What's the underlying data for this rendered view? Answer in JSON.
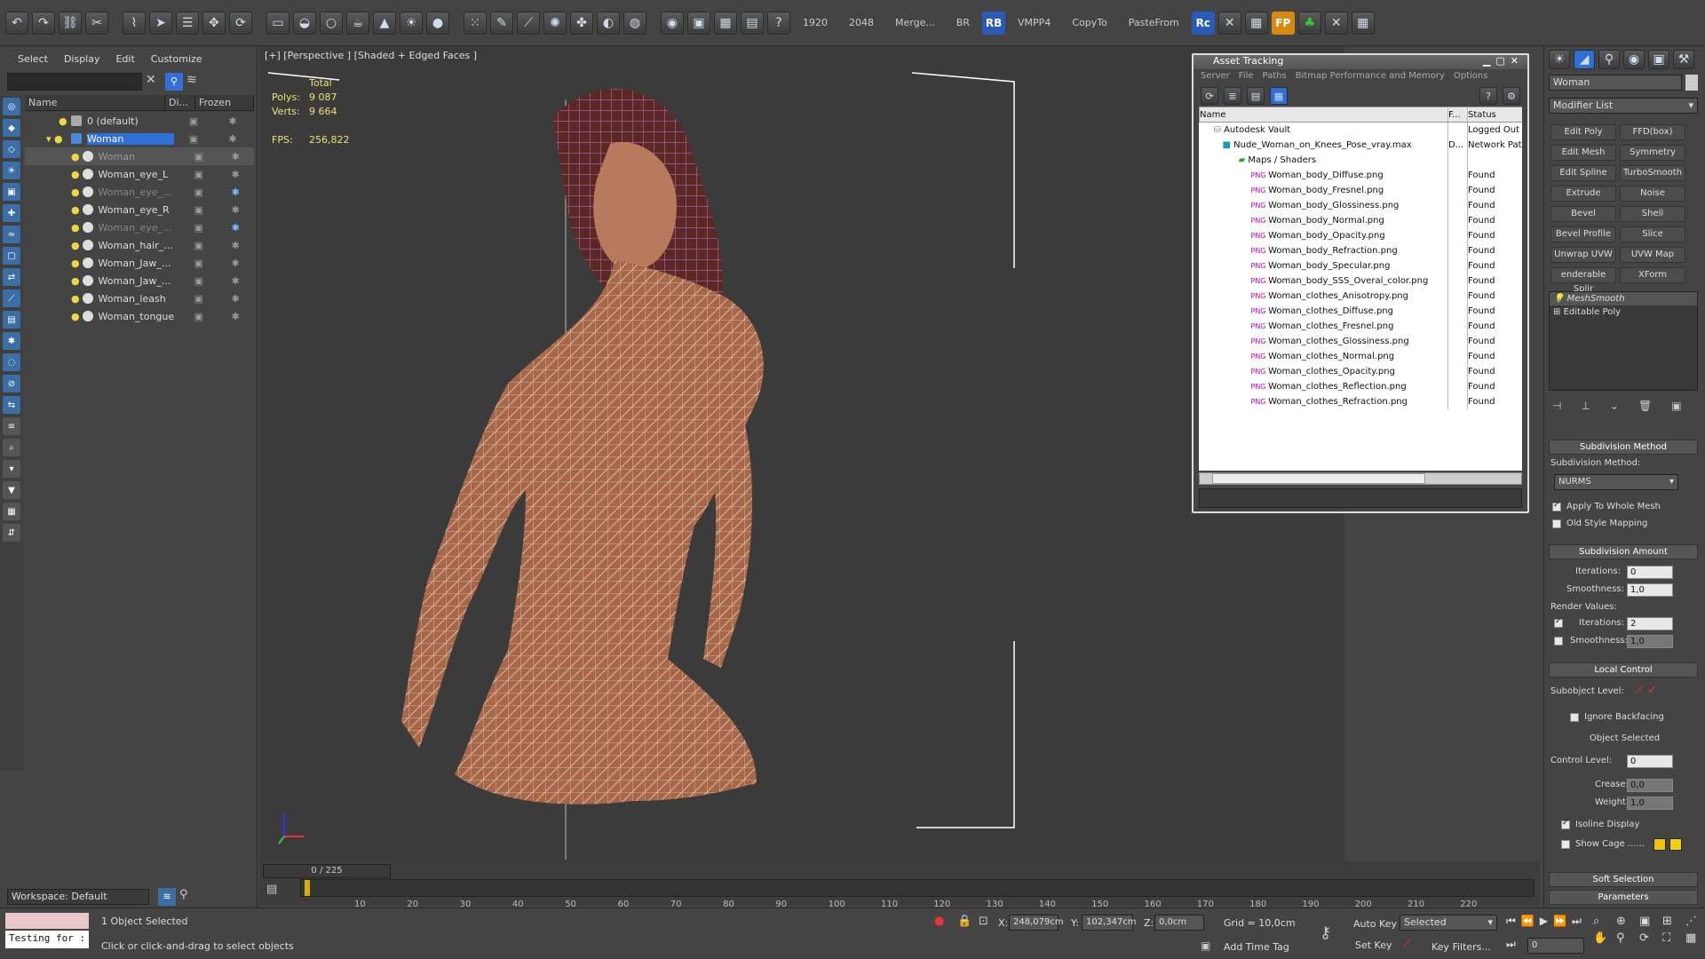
{
  "toolbar": {
    "res1": "1920",
    "res2": "2048",
    "merge": "Merge...",
    "br": "BR",
    "rb": "RB",
    "vmpp": "VMPP4",
    "copyto": "CopyTo",
    "pastefrom": "PasteFrom",
    "rc": "Rc",
    "fp": "FP"
  },
  "scene": {
    "menus": [
      "Select",
      "Display",
      "Edit",
      "Customize"
    ],
    "columns": [
      "Name",
      "Di...",
      "Frozen"
    ],
    "rows": [
      {
        "name": "0 (default)"
      },
      {
        "name": "Woman"
      },
      {
        "name": "Woman"
      },
      {
        "name": "Woman_eye_L"
      },
      {
        "name": "Woman_eye_..."
      },
      {
        "name": "Woman_eye_R"
      },
      {
        "name": "Woman_eye_..."
      },
      {
        "name": "Woman_hair_..."
      },
      {
        "name": "Woman_Jaw_..."
      },
      {
        "name": "Woman_Jaw_..."
      },
      {
        "name": "Woman_leash"
      },
      {
        "name": "Woman_tongue"
      }
    ],
    "workspace": "Workspace: Default"
  },
  "viewport": {
    "label": "[+] [Perspective ] [Shaded + Edged Faces ]",
    "stats_total": "Total",
    "polys_label": "Polys:",
    "polys_value": "9 087",
    "verts_label": "Verts:",
    "verts_value": "9 664",
    "fps_label": "FPS:",
    "fps_value": "256,822"
  },
  "asset": {
    "title": "Asset Tracking",
    "menus": [
      "Server",
      "File",
      "Paths",
      "Bitmap Performance and Memory",
      "Options"
    ],
    "headers": [
      "Name",
      "F...",
      "Status"
    ],
    "rows": [
      {
        "name": "Autodesk Vault",
        "f": "",
        "status": "Logged Out"
      },
      {
        "name": "Nude_Woman_on_Knees_Pose_vray.max",
        "f": "D...",
        "status": "Network Path"
      },
      {
        "name": "Maps / Shaders",
        "f": "",
        "status": ""
      },
      {
        "name": "Woman_body_Diffuse.png",
        "f": "",
        "status": "Found"
      },
      {
        "name": "Woman_body_Fresnel.png",
        "f": "",
        "status": "Found"
      },
      {
        "name": "Woman_body_Glossiness.png",
        "f": "",
        "status": "Found"
      },
      {
        "name": "Woman_body_Normal.png",
        "f": "",
        "status": "Found"
      },
      {
        "name": "Woman_body_Opacity.png",
        "f": "",
        "status": "Found"
      },
      {
        "name": "Woman_body_Refraction.png",
        "f": "",
        "status": "Found"
      },
      {
        "name": "Woman_body_Specular.png",
        "f": "",
        "status": "Found"
      },
      {
        "name": "Woman_body_SSS_Overal_color.png",
        "f": "",
        "status": "Found"
      },
      {
        "name": "Woman_clothes_Anisotropy.png",
        "f": "",
        "status": "Found"
      },
      {
        "name": "Woman_clothes_Diffuse.png",
        "f": "",
        "status": "Found"
      },
      {
        "name": "Woman_clothes_Fresnel.png",
        "f": "",
        "status": "Found"
      },
      {
        "name": "Woman_clothes_Glossiness.png",
        "f": "",
        "status": "Found"
      },
      {
        "name": "Woman_clothes_Normal.png",
        "f": "",
        "status": "Found"
      },
      {
        "name": "Woman_clothes_Opacity.png",
        "f": "",
        "status": "Found"
      },
      {
        "name": "Woman_clothes_Reflection.png",
        "f": "",
        "status": "Found"
      },
      {
        "name": "Woman_clothes_Refraction.png",
        "f": "",
        "status": "Found"
      }
    ]
  },
  "command": {
    "object_name": "Woman",
    "modifier_list": "Modifier List",
    "modifiers": [
      "Edit Poly",
      "FFD(box)",
      "Edit Mesh",
      "Symmetry",
      "Edit Spline",
      "TurboSmooth",
      "Extrude",
      "Noise",
      "Bevel",
      "Shell",
      "Bevel Profile",
      "Slice",
      "Unwrap UVW",
      "UVW Map",
      "enderable Splir",
      "XForm"
    ],
    "stack": [
      "MeshSmooth",
      "Editable Poly"
    ],
    "subdiv_method_title": "Subdivision Method",
    "subdiv_method_label": "Subdivision Method:",
    "subdiv_method_value": "NURMS",
    "apply_whole": "Apply To Whole Mesh",
    "old_style": "Old Style Mapping",
    "subdiv_amount_title": "Subdivision Amount",
    "iterations_label": "Iterations:",
    "iterations_value": "0",
    "smoothness_label": "Smoothness:",
    "smoothness_value": "1,0",
    "render_values": "Render Values:",
    "r_iterations_label": "Iterations:",
    "r_iterations_value": "2",
    "r_smoothness_label": "Smoothness:",
    "r_smoothness_value": "1,0",
    "local_control_title": "Local Control",
    "subobject_level": "Subobject Level:",
    "ignore_backfacing": "Ignore Backfacing",
    "object_selected": "Object Selected",
    "control_level_label": "Control Level:",
    "control_level_value": "0",
    "crease_label": "Crease:",
    "crease_value": "0,0",
    "weight_label": "Weight:",
    "weight_value": "1,0",
    "isoline": "Isoline Display",
    "show_cage": "Show Cage ......",
    "soft_selection": "Soft Selection",
    "parameters": "Parameters"
  },
  "timeline": {
    "frame": "0 / 225",
    "ticks": [
      "10",
      "20",
      "30",
      "40",
      "50",
      "60",
      "70",
      "80",
      "90",
      "100",
      "110",
      "120",
      "130",
      "140",
      "150",
      "160",
      "170",
      "180",
      "190",
      "200",
      "210",
      "220"
    ]
  },
  "status": {
    "maxscript": "Testing for :",
    "selected": "1 Object Selected",
    "prompt": "Click or click-and-drag to select objects",
    "x_label": "X:",
    "x_value": "248,079cm",
    "y_label": "Y:",
    "y_value": "102,347cm",
    "z_label": "Z:",
    "z_value": "0,0cm",
    "grid": "Grid = 10,0cm",
    "add_time_tag": "Add Time Tag",
    "auto_key": "Auto Key",
    "set_key": "Set Key",
    "selected_dd": "Selected",
    "key_filters": "Key Filters...",
    "frame_field": "0"
  }
}
